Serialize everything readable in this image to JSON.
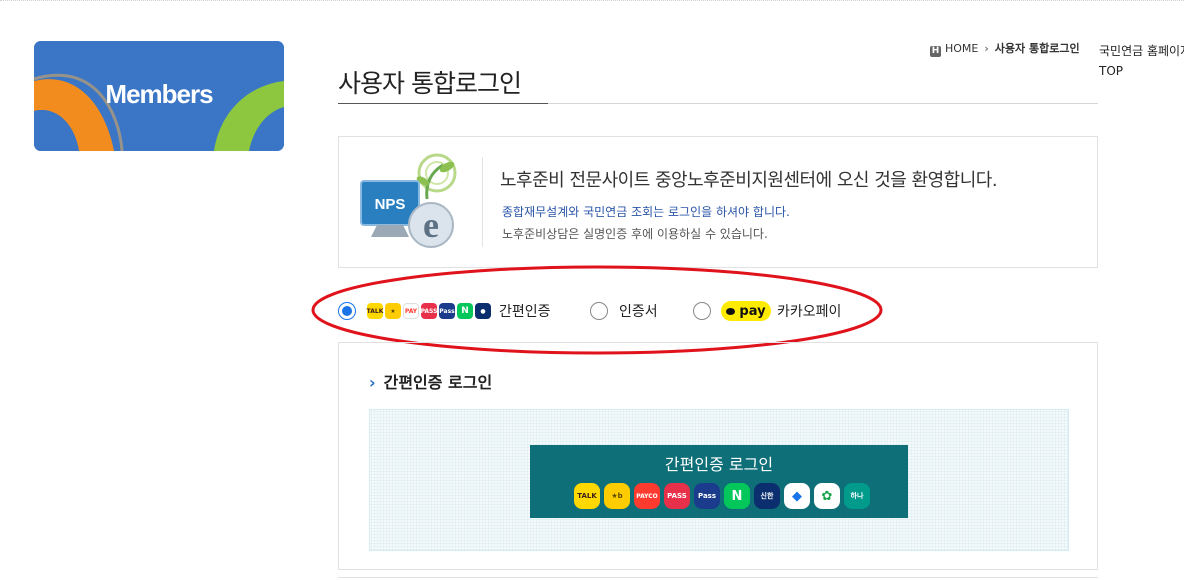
{
  "members_banner": {
    "title": "Members"
  },
  "breadcrumb": {
    "home": "HOME",
    "separator": "›",
    "current": "사용자 통합로그인"
  },
  "right_links": {
    "home_link": "국민연금 홈페이지",
    "top_link": "TOP"
  },
  "page_title": "사용자 통합로그인",
  "welcome": {
    "logo_text": "NPS",
    "heading": "노후준비 전문사이트 중앙노후준비지원센터에 오신 것을 환영합니다.",
    "sub1": "종합재무설계와 국민연금 조회는 로그인을 하셔야 합니다.",
    "sub2": "노후준비상담은 실명인증 후에 이용하실 수 있습니다."
  },
  "login_options": [
    {
      "label": "간편인증",
      "selected": true,
      "icons": [
        "kakaotalk-icon",
        "kb-icon",
        "payco-icon",
        "pass-icon",
        "samsung-pass-icon",
        "naver-icon",
        "shinhan-icon"
      ]
    },
    {
      "label": "인증서",
      "selected": false
    },
    {
      "label": "카카오페이",
      "selected": false,
      "badge": "pay"
    }
  ],
  "auth_panel": {
    "heading": "간편인증 로그인",
    "button_label": "간편인증 로그인",
    "providers": [
      {
        "name": "kakaotalk-icon",
        "text": "TALK",
        "bg": "#ffd800",
        "fg": "#3a1d1d"
      },
      {
        "name": "kb-icon",
        "text": "★b",
        "bg": "#ffcc00",
        "fg": "#5a4a00"
      },
      {
        "name": "payco-icon",
        "text": "PAYCO",
        "bg": "#ff3b30",
        "fg": "#ffffff"
      },
      {
        "name": "pass-icon",
        "text": "PASS",
        "bg": "#e8304a",
        "fg": "#ffffff"
      },
      {
        "name": "samsung-pass-icon",
        "text": "Pass",
        "bg": "#1b3c8c",
        "fg": "#ffffff"
      },
      {
        "name": "naver-icon",
        "text": "N",
        "bg": "#03c75a",
        "fg": "#ffffff"
      },
      {
        "name": "shinhan-icon",
        "text": "신한",
        "bg": "#0a2e6e",
        "fg": "#ffffff"
      },
      {
        "name": "toss-icon",
        "text": "◆",
        "bg": "#ffffff",
        "fg": "#1a73e8"
      },
      {
        "name": "naver-cert-icon",
        "text": "✿",
        "bg": "#ffffff",
        "fg": "#17a34a"
      },
      {
        "name": "hana-icon",
        "text": "하나",
        "bg": "#009b8b",
        "fg": "#ffffff"
      }
    ]
  },
  "colors": {
    "accent": "#0f6f78",
    "radio_selected": "#1a73e8",
    "annotation_red": "#e0121b"
  }
}
